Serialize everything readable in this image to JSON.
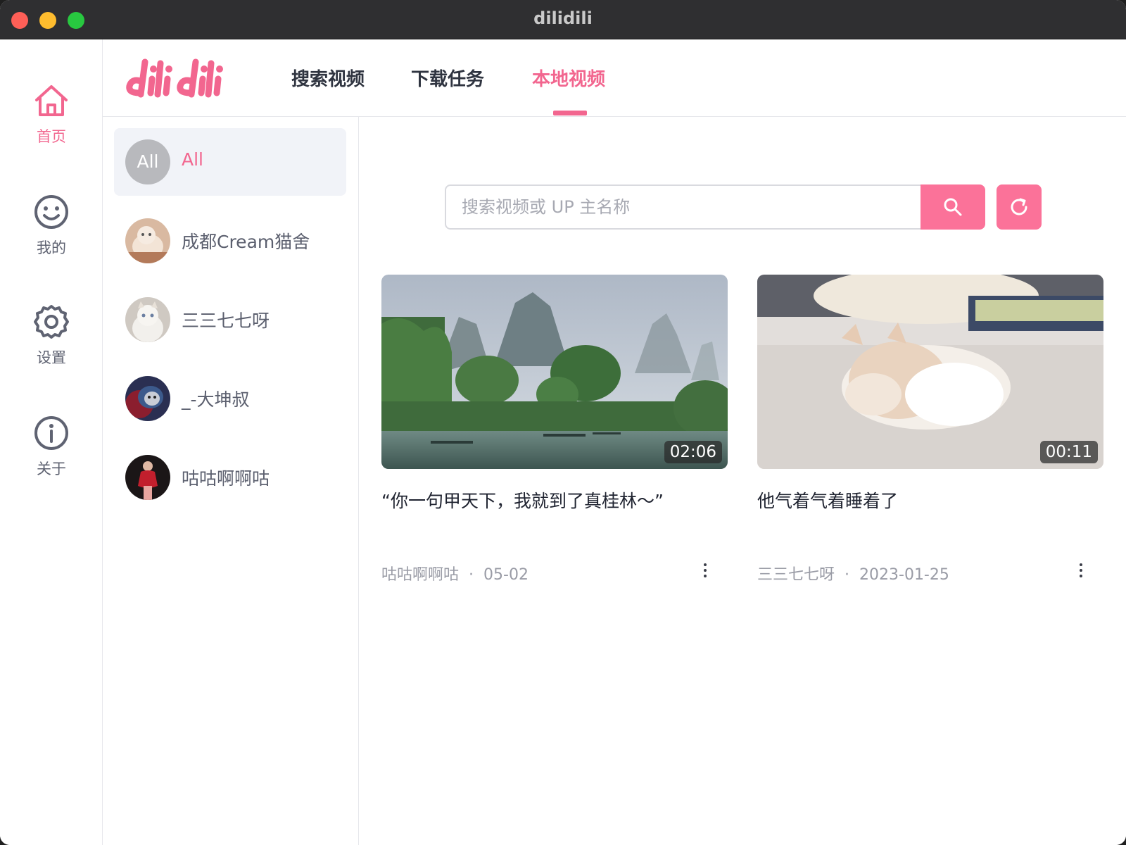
{
  "window": {
    "title": "dilidili"
  },
  "rail": {
    "items": [
      {
        "label": "首页",
        "icon": "home-icon",
        "active": true
      },
      {
        "label": "我的",
        "icon": "smile-icon",
        "active": false
      },
      {
        "label": "设置",
        "icon": "gear-icon",
        "active": false
      },
      {
        "label": "关于",
        "icon": "info-icon",
        "active": false
      }
    ]
  },
  "header": {
    "logo_text": "dilidili",
    "tabs": [
      {
        "label": "搜索视频",
        "active": false
      },
      {
        "label": "下载任务",
        "active": false
      },
      {
        "label": "本地视频",
        "active": true
      }
    ]
  },
  "uploaders": [
    {
      "name": "All",
      "avatar_text": "All",
      "active": true
    },
    {
      "name": "成都Cream猫舍",
      "active": false
    },
    {
      "name": "三三七七呀",
      "active": false
    },
    {
      "name": "_-大坤叔",
      "active": false
    },
    {
      "name": "咕咕啊啊咕",
      "active": false
    }
  ],
  "search": {
    "placeholder": "搜索视频或 UP 主名称",
    "value": ""
  },
  "videos": [
    {
      "title": "“你一句甲天下，我就到了真桂林～”",
      "uploader": "咕咕啊啊咕",
      "date": "05-02",
      "duration": "02:06"
    },
    {
      "title": "他气着气着睡着了",
      "uploader": "三三七七呀",
      "date": "2023-01-25",
      "duration": "00:11"
    }
  ],
  "colors": {
    "accent": "#fb7299",
    "accent_text": "#f2668f",
    "titlebar": "#2f2f31"
  }
}
